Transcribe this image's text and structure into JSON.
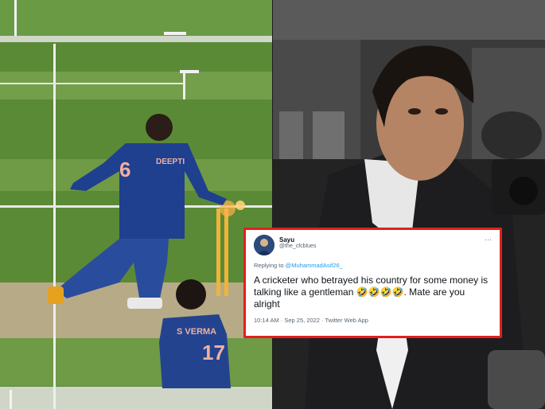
{
  "left_panel": {
    "player_main_jersey_name": "DEEPTI",
    "player_main_jersey_number": "6",
    "player_back_jersey_name": "S VERMA",
    "player_back_jersey_number": "17"
  },
  "tweet": {
    "display_name": "Sayu",
    "handle": "@the_cfcblues",
    "replying_prefix": "Replying to ",
    "replying_mention": "@MuhammadAsif26_",
    "text": "A cricketer who betrayed his country for some money is talking like a gentleman 🤣🤣🤣🤣. Mate are you alright",
    "timestamp": "10:14 AM · Sep 25, 2022 · Twitter Web App",
    "more_glyph": "···"
  },
  "colors": {
    "card_border": "#e0201f",
    "mention": "#1d9bf0",
    "pitch_green": "#5f8d3a",
    "jersey_blue": "#1f3f8f"
  }
}
